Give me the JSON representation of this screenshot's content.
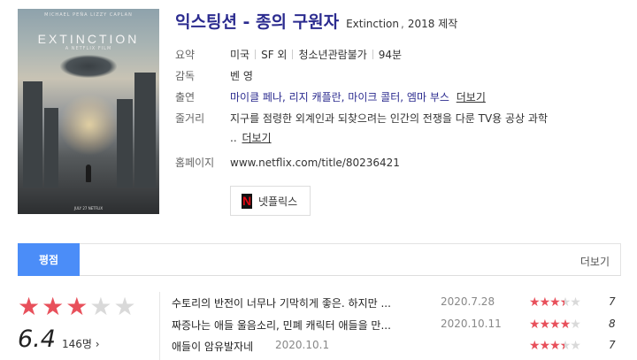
{
  "movie": {
    "title": "익스팅션 - 종의 구원자",
    "original_title": "Extinction",
    "year_made": "2018 제작",
    "poster": {
      "cast_line": "MICHAEL PEÑA LIZZY CAPLAN",
      "logo_text": "EXTINCTION",
      "studio_text": "A NETFLIX FILM",
      "release_text": "JULY 27 NETFLIX"
    }
  },
  "info": {
    "summary_label": "요약",
    "summary": [
      "미국",
      "SF 외",
      "청소년관람불가",
      "94분"
    ],
    "director_label": "감독",
    "director": "벤 영",
    "cast_label": "출연",
    "cast": "마이클 페나, 리지 캐플란, 마이크 콜터, 엠마 부스",
    "cast_more": "더보기",
    "plot_label": "줄거리",
    "plot": "지구를 점령한 외계인과 되찾으려는 인간의 전쟁을 다룬 TV용 공상 과학",
    "plot_cont": "..",
    "plot_more": "더보기",
    "homepage_label": "홈페이지",
    "homepage": "www.netflix.com/title/80236421"
  },
  "ott": {
    "logo": "N",
    "label": "넷플릭스",
    "brand_color": "#e50914"
  },
  "tabs": {
    "active": "평점",
    "more": "더보기"
  },
  "rating": {
    "score": "6.4",
    "count": "146명 ›",
    "stars_filled": 3,
    "stars_total": 5,
    "accent_color": "#e8505b"
  },
  "reviews": [
    {
      "text": "수토리의 반전이 너무나 기막히게 좋은. 하지만 ...",
      "date": "2020.7.28",
      "score": "7",
      "stars": 3.5
    },
    {
      "text": "짜증나는 애들 울음소리, 민폐 캐릭터 애들을 만...",
      "date": "2020.10.11",
      "score": "8",
      "stars": 4
    },
    {
      "text": "애들이 암유발자네",
      "date": "2020.10.1",
      "score": "7",
      "stars": 3.5
    }
  ]
}
